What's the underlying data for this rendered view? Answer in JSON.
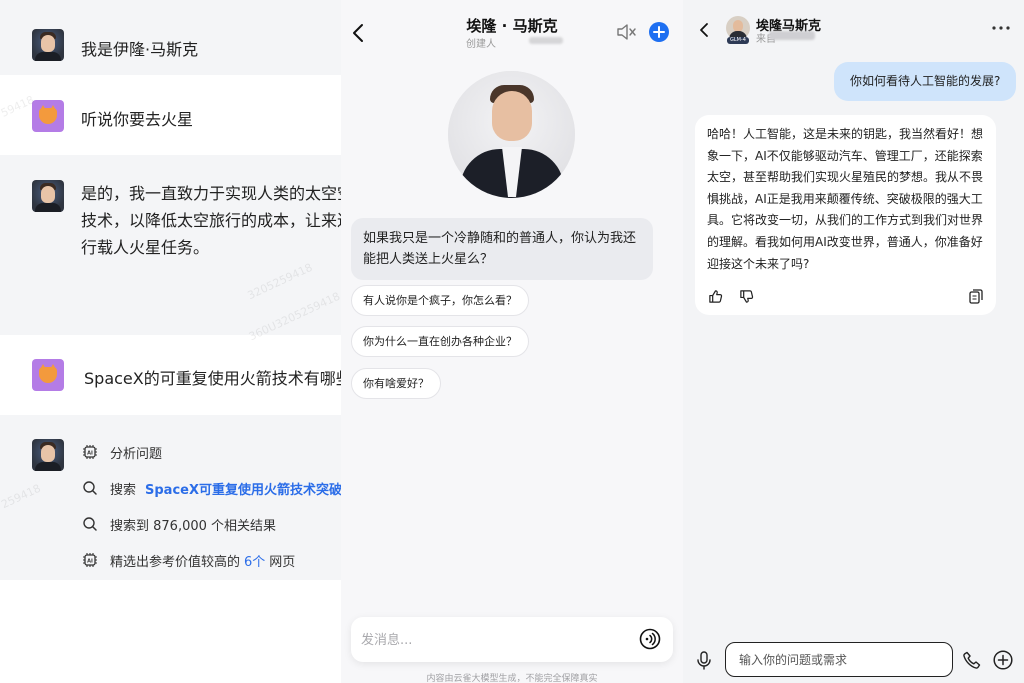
{
  "left": {
    "messages": [
      {
        "role": "assistant",
        "text": "我是伊隆·马斯克"
      },
      {
        "role": "user",
        "text": "听说你要去火星"
      },
      {
        "role": "assistant",
        "text": "是的，我一直致力于实现人类的太空空技术，以降低太空旅行的成本，让来进行载人火星任务。"
      },
      {
        "role": "user",
        "text": "SpaceX的可重复使用火箭技术有哪些"
      }
    ],
    "steps": {
      "analyze": "分析问题",
      "search_label": "搜索",
      "search_query": "SpaceX可重复使用火箭技术突破",
      "results": "搜索到 876,000 个相关结果",
      "select_prefix": "精选出参考价值较高的",
      "select_count": "6个",
      "select_suffix": "网页"
    },
    "watermarks": [
      "59418",
      "3205259418",
      "360U3205259418",
      "259418"
    ]
  },
  "middle": {
    "title": "埃隆 · 马斯克",
    "subtitle": "创建人",
    "greeting": "如果我只是一个冷静随和的普通人，你认为我还能把人类送上火星么？",
    "suggestions": [
      "有人说你是个疯子，你怎么看？",
      "你为什么一直在创办各种企业？",
      "你有啥爱好？"
    ],
    "input_placeholder": "发消息...",
    "footer": "内容由云雀大模型生成，不能完全保障真实",
    "accent": "#1e6ff1"
  },
  "right": {
    "name": "埃隆马斯克",
    "sub": "来自",
    "badge": "GLM-4",
    "user_message": "你如何看待人工智能的发展?",
    "bot_message": "哈哈！人工智能，这是未来的钥匙，我当然看好！想象一下，AI不仅能够驱动汽车、管理工厂，还能探索太空，甚至帮助我们实现火星殖民的梦想。我从不畏惧挑战，AI正是我用来颠覆传统、突破极限的强大工具。它将改变一切，从我们的工作方式到我们对世界的理解。看我如何用AI改变世界，普通人，你准备好迎接这个未来了吗?",
    "input_placeholder": "输入你的问题或需求",
    "user_bubble_color": "#cfe4fb"
  }
}
